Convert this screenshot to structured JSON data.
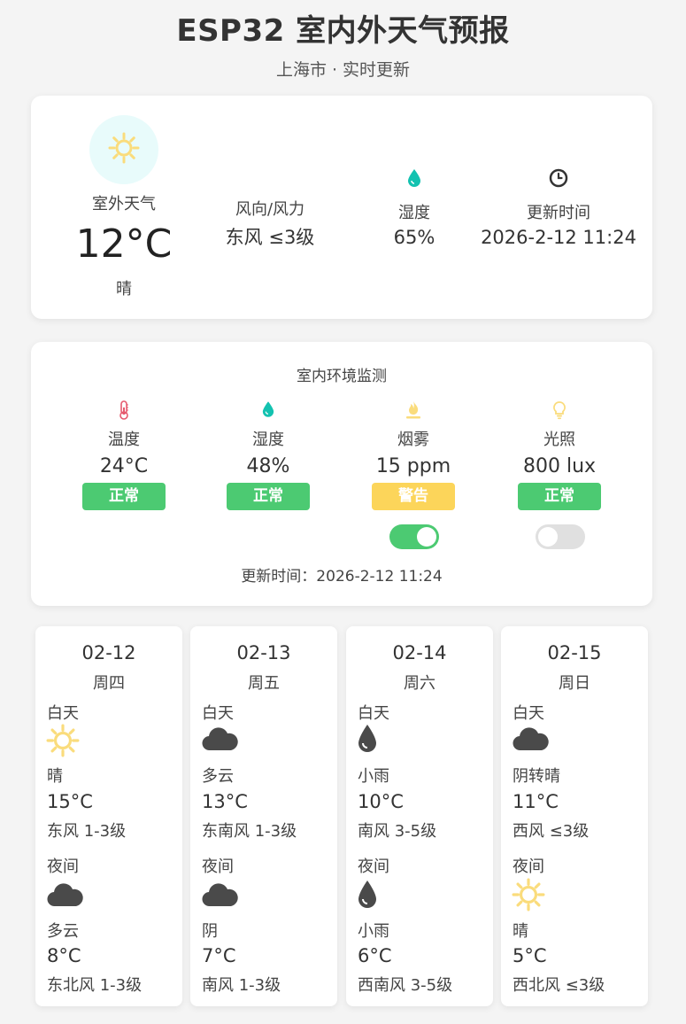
{
  "header": {
    "title": "ESP32 室内外天气预报",
    "subtitle": "上海市 · 实时更新"
  },
  "outdoor": {
    "label": "室外天气",
    "temp": "12°C",
    "condition": "晴",
    "wind_label": "风向/风力",
    "wind_value": "东风 ≤3级",
    "humidity_label": "湿度",
    "humidity_value": "65%",
    "update_label": "更新时间",
    "update_value": "2026-2-12 11:24",
    "icons": {
      "weather": "sun-icon",
      "humidity": "water-drop-icon",
      "time": "clock-icon"
    }
  },
  "indoor": {
    "title": "室内环境监测",
    "sensors": [
      {
        "label": "温度",
        "value": "24°C",
        "status": "正常",
        "icon": "thermometer-icon",
        "status_color": "#4cca72"
      },
      {
        "label": "湿度",
        "value": "48%",
        "status": "正常",
        "icon": "water-drop-icon",
        "status_color": "#4cca72"
      },
      {
        "label": "烟雾",
        "value": "15 ppm",
        "status": "警告",
        "icon": "flame-icon",
        "status_color": "#fcd55a"
      },
      {
        "label": "光照",
        "value": "800 lux",
        "status": "正常",
        "icon": "bulb-icon",
        "status_color": "#4cca72"
      }
    ],
    "toggles": {
      "smoke_alarm": true,
      "light": false
    },
    "update_text": "更新时间：2026-2-12 11:24"
  },
  "forecast": [
    {
      "date": "02-12",
      "weekday": "周四",
      "day": {
        "label": "白天",
        "icon": "sun-icon",
        "condition": "晴",
        "temp": "15°C",
        "wind": "东风 1-3级"
      },
      "night": {
        "label": "夜间",
        "icon": "cloud-icon",
        "condition": "多云",
        "temp": "8°C",
        "wind": "东北风 1-3级"
      }
    },
    {
      "date": "02-13",
      "weekday": "周五",
      "day": {
        "label": "白天",
        "icon": "cloud-icon",
        "condition": "多云",
        "temp": "13°C",
        "wind": "东南风 1-3级"
      },
      "night": {
        "label": "夜间",
        "icon": "cloud-icon",
        "condition": "阴",
        "temp": "7°C",
        "wind": "南风 1-3级"
      }
    },
    {
      "date": "02-14",
      "weekday": "周六",
      "day": {
        "label": "白天",
        "icon": "rain-drop-icon",
        "condition": "小雨",
        "temp": "10°C",
        "wind": "南风 3-5级"
      },
      "night": {
        "label": "夜间",
        "icon": "rain-drop-icon",
        "condition": "小雨",
        "temp": "6°C",
        "wind": "西南风 3-5级"
      }
    },
    {
      "date": "02-15",
      "weekday": "周日",
      "day": {
        "label": "白天",
        "icon": "cloud-icon",
        "condition": "阴转晴",
        "temp": "11°C",
        "wind": "西风 ≤3级"
      },
      "night": {
        "label": "夜间",
        "icon": "sun-icon",
        "condition": "晴",
        "temp": "5°C",
        "wind": "西北风 ≤3级"
      }
    }
  ],
  "colors": {
    "sun": "#fadc7c",
    "teal": "#13c2b0",
    "cloud": "#4a4a4a",
    "normal": "#4cca72",
    "warning": "#fcd55a",
    "toggle_on": "#4cca72",
    "toggle_off": "#e0e0e0"
  }
}
